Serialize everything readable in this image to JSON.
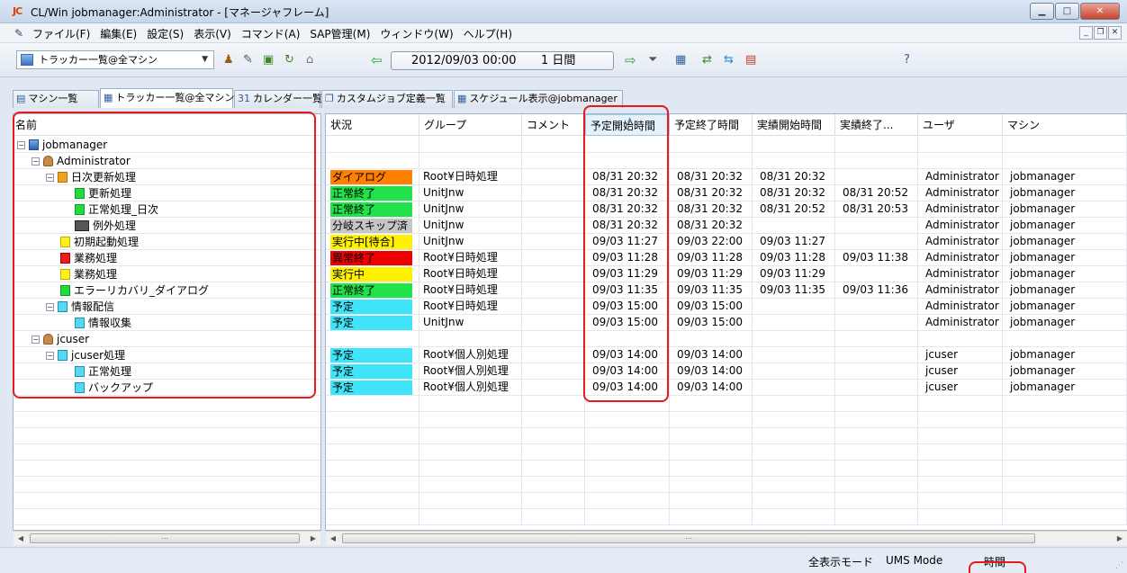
{
  "window": {
    "app_logo": "JC",
    "title": "CL/Win jobmanager:Administrator - [マネージャフレーム]"
  },
  "menu": [
    "ファイル(F)",
    "編集(E)",
    "設定(S)",
    "表示(V)",
    "コマンド(A)",
    "SAP管理(M)",
    "ウィンドウ(W)",
    "ヘルプ(H)"
  ],
  "toolbar": {
    "view_selector": "トラッカー一覧@全マシン",
    "date": "2012/09/03 00:00",
    "period": "1 日間"
  },
  "tabs": [
    "マシン一覧",
    "トラッカー一覧@全マシン",
    "カレンダー一覧",
    "カスタムジョブ定義一覧",
    "スケジュール表示@jobmanager"
  ],
  "tabs_icons": [
    "▤",
    "▦",
    "31",
    "❐",
    "▦"
  ],
  "tree": {
    "header": "名前",
    "nodes": [
      {
        "label": "jobmanager"
      },
      {
        "label": "Administrator"
      },
      {
        "label": "日次更新処理"
      },
      {
        "label": "更新処理"
      },
      {
        "label": "正常処理_日次"
      },
      {
        "label": "例外処理"
      },
      {
        "label": "初期起動処理"
      },
      {
        "label": "業務処理"
      },
      {
        "label": "業務処理"
      },
      {
        "label": "エラーリカバリ_ダイアログ"
      },
      {
        "label": "情報配信"
      },
      {
        "label": "情報収集"
      },
      {
        "label": "jcuser"
      },
      {
        "label": "jcuser処理"
      },
      {
        "label": "正常処理"
      },
      {
        "label": "バックアップ"
      }
    ]
  },
  "grid": {
    "columns": [
      "状況",
      "グループ",
      "コメント",
      "予定開始時間",
      "予定終了時間",
      "実績開始時間",
      "実績終了...",
      "ユーザ",
      "マシン"
    ],
    "rows": [
      {
        "status": "",
        "group": "",
        "comment": "",
        "plan_start": "",
        "plan_end": "",
        "act_start": "",
        "act_end": "",
        "user": "",
        "machine": ""
      },
      {
        "status": "",
        "group": "",
        "comment": "",
        "plan_start": "",
        "plan_end": "",
        "act_start": "",
        "act_end": "",
        "user": "",
        "machine": ""
      },
      {
        "status": "ダイアログ",
        "group": "Root¥日時処理",
        "comment": "",
        "plan_start": "08/31 20:32",
        "plan_end": "08/31 20:32",
        "act_start": "08/31 20:32",
        "act_end": "",
        "user": "Administrator",
        "machine": "jobmanager"
      },
      {
        "status": "正常終了",
        "group": "UnitJnw",
        "comment": "",
        "plan_start": "08/31 20:32",
        "plan_end": "08/31 20:32",
        "act_start": "08/31 20:32",
        "act_end": "08/31 20:52",
        "user": "Administrator",
        "machine": "jobmanager"
      },
      {
        "status": "正常終了",
        "group": "UnitJnw",
        "comment": "",
        "plan_start": "08/31 20:32",
        "plan_end": "08/31 20:32",
        "act_start": "08/31 20:52",
        "act_end": "08/31 20:53",
        "user": "Administrator",
        "machine": "jobmanager"
      },
      {
        "status": "分岐スキップ済",
        "group": "UnitJnw",
        "comment": "",
        "plan_start": "08/31 20:32",
        "plan_end": "08/31 20:32",
        "act_start": "",
        "act_end": "",
        "user": "Administrator",
        "machine": "jobmanager"
      },
      {
        "status": "実行中[待合]",
        "group": "UnitJnw",
        "comment": "",
        "plan_start": "09/03 11:27",
        "plan_end": "09/03 22:00",
        "act_start": "09/03 11:27",
        "act_end": "",
        "user": "Administrator",
        "machine": "jobmanager"
      },
      {
        "status": "異常終了",
        "group": "Root¥日時処理",
        "comment": "",
        "plan_start": "09/03 11:28",
        "plan_end": "09/03 11:28",
        "act_start": "09/03 11:28",
        "act_end": "09/03 11:38",
        "user": "Administrator",
        "machine": "jobmanager"
      },
      {
        "status": "実行中",
        "group": "Root¥日時処理",
        "comment": "",
        "plan_start": "09/03 11:29",
        "plan_end": "09/03 11:29",
        "act_start": "09/03 11:29",
        "act_end": "",
        "user": "Administrator",
        "machine": "jobmanager"
      },
      {
        "status": "正常終了",
        "group": "Root¥日時処理",
        "comment": "",
        "plan_start": "09/03 11:35",
        "plan_end": "09/03 11:35",
        "act_start": "09/03 11:35",
        "act_end": "09/03 11:36",
        "user": "Administrator",
        "machine": "jobmanager"
      },
      {
        "status": "予定",
        "group": "Root¥日時処理",
        "comment": "",
        "plan_start": "09/03 15:00",
        "plan_end": "09/03 15:00",
        "act_start": "",
        "act_end": "",
        "user": "Administrator",
        "machine": "jobmanager"
      },
      {
        "status": "予定",
        "group": "UnitJnw",
        "comment": "",
        "plan_start": "09/03 15:00",
        "plan_end": "09/03 15:00",
        "act_start": "",
        "act_end": "",
        "user": "Administrator",
        "machine": "jobmanager"
      },
      {
        "status": "",
        "group": "",
        "comment": "",
        "plan_start": "",
        "plan_end": "",
        "act_start": "",
        "act_end": "",
        "user": "",
        "machine": ""
      },
      {
        "status": "予定",
        "group": "Root¥個人別処理",
        "comment": "",
        "plan_start": "09/03 14:00",
        "plan_end": "09/03 14:00",
        "act_start": "",
        "act_end": "",
        "user": "jcuser",
        "machine": "jobmanager"
      },
      {
        "status": "予定",
        "group": "Root¥個人別処理",
        "comment": "",
        "plan_start": "09/03 14:00",
        "plan_end": "09/03 14:00",
        "act_start": "",
        "act_end": "",
        "user": "jcuser",
        "machine": "jobmanager"
      },
      {
        "status": "予定",
        "group": "Root¥個人別処理",
        "comment": "",
        "plan_start": "09/03 14:00",
        "plan_end": "09/03 14:00",
        "act_start": "",
        "act_end": "",
        "user": "jcuser",
        "machine": "jobmanager"
      }
    ]
  },
  "status_colors": {
    "ダイアログ": "#ff7f00",
    "正常終了": "#22e24a",
    "分岐スキップ済": "#c6c6c6",
    "実行中[待合]": "#fff100",
    "異常終了": "#ee0000",
    "実行中": "#fff100",
    "予定": "#3fe4f8"
  },
  "statusbar": {
    "display_mode": "全表示モード",
    "ums": "UMS Mode",
    "time": "時間"
  }
}
